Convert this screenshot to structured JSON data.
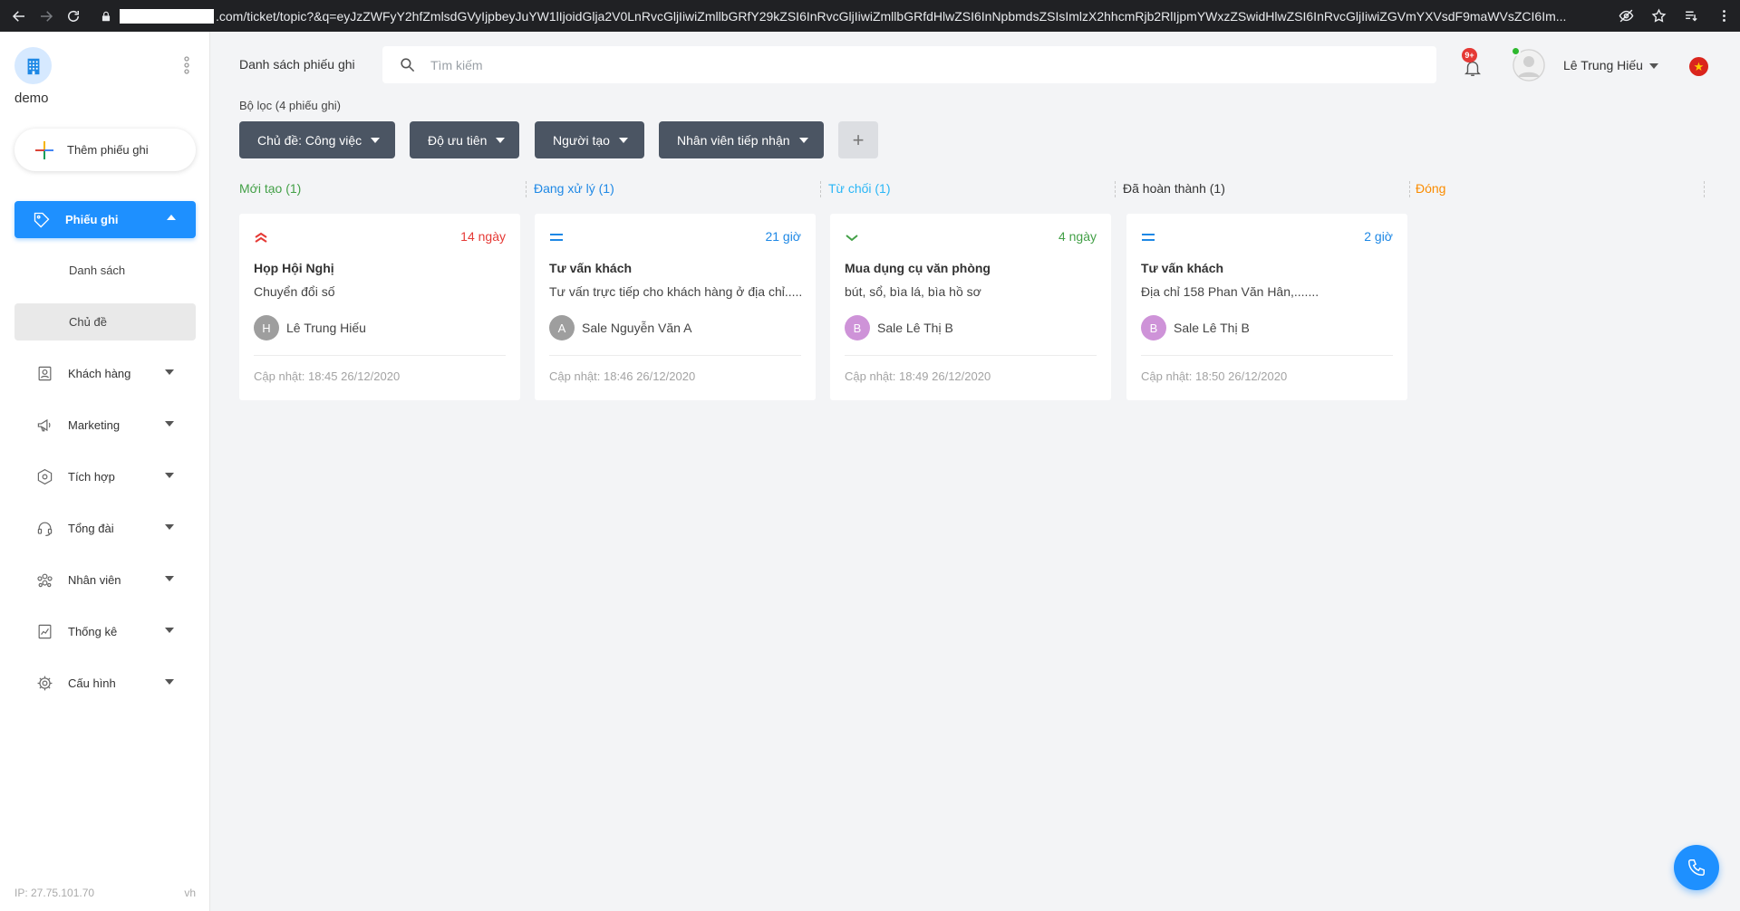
{
  "browser": {
    "url_tail": ".com/ticket/topic?&q=eyJzZWFyY2hfZmlsdGVyIjpbeyJuYW1lIjoidGlja2V0LnRvcGljIiwiZmllbGRfY29kZSI6InRvcGljIiwiZmllbGRfdHlwZSI6InNpbmdsZSIsImlzX2hhcmRjb2RlIjpmYWxzZSwidHlwZSI6InRvcGljIiwiZGVmYXVsdF9maWVsZCI6Im..."
  },
  "sidebar": {
    "org_name": "demo",
    "add_label": "Thêm phiếu ghi",
    "active_label": "Phiếu ghi",
    "sub_items": [
      "Danh sách",
      "Chủ đề"
    ],
    "items": [
      "Khách hàng",
      "Marketing",
      "Tích hợp",
      "Tổng đài",
      "Nhân viên",
      "Thống kê",
      "Cấu hình"
    ],
    "ip": "IP: 27.75.101.70",
    "lang": "vh"
  },
  "header": {
    "title": "Danh sách phiếu ghi",
    "search_placeholder": "Tìm kiếm",
    "notif_badge": "9+",
    "user_name": "Lê Trung Hiếu"
  },
  "filters": {
    "count_label": "Bộ lọc (4 phiếu ghi)",
    "buttons": [
      "Chủ đề: Công việc",
      "Độ ưu tiên",
      "Người tạo",
      "Nhân viên tiếp nhận"
    ],
    "add": "+"
  },
  "columns": [
    {
      "label": "Mới tạo (1)",
      "color": "#43a047"
    },
    {
      "label": "Đang xử lý (1)",
      "color": "#1e88e5"
    },
    {
      "label": "Từ chối (1)",
      "color": "#29b6f6"
    },
    {
      "label": "Đã hoàn thành (1)",
      "color": "#333333"
    },
    {
      "label": "Đóng",
      "color": "#fb8c00"
    }
  ],
  "cards": [
    {
      "priority": "high",
      "age": "14 ngày",
      "age_color": "#e53935",
      "title": "Họp Hội Nghị",
      "desc": "Chuyển đổi số",
      "avatar": "H",
      "avatar_color": "#9e9e9e",
      "owner": "Lê Trung Hiếu",
      "updated": "Cập nhật: 18:45 26/12/2020"
    },
    {
      "priority": "medium",
      "age": "21 giờ",
      "age_color": "#1e88e5",
      "title": "Tư vấn khách",
      "desc": "Tư vấn trực tiếp cho khách hàng ở địa chỉ.....",
      "avatar": "A",
      "avatar_color": "#9e9e9e",
      "owner": "Sale Nguyễn Văn A",
      "updated": "Cập nhật: 18:46 26/12/2020"
    },
    {
      "priority": "low",
      "age": "4 ngày",
      "age_color": "#43a047",
      "title": "Mua dụng cụ văn phòng",
      "desc": "bút, sổ, bìa lá, bìa hồ sơ",
      "avatar": "B",
      "avatar_color": "#ce93d8",
      "owner": "Sale Lê Thị B",
      "updated": "Cập nhật: 18:49 26/12/2020"
    },
    {
      "priority": "medium",
      "age": "2 giờ",
      "age_color": "#1e88e5",
      "title": "Tư vấn khách",
      "desc": "Địa chỉ 158 Phan Văn Hân,.......",
      "avatar": "B",
      "avatar_color": "#ce93d8",
      "owner": "Sale Lê Thị B",
      "updated": "Cập nhật: 18:50 26/12/2020"
    }
  ]
}
